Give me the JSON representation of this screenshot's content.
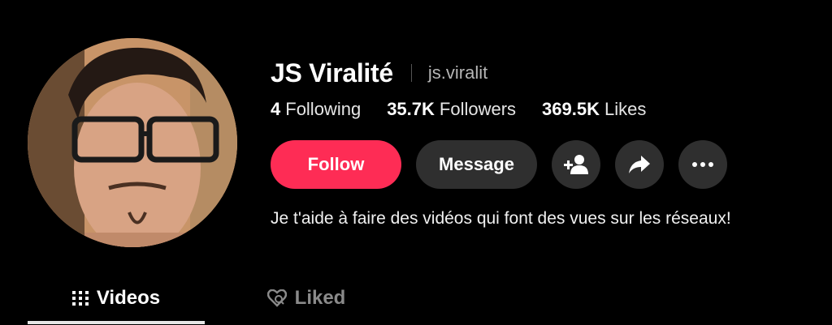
{
  "profile": {
    "display_name": "JS Viralité",
    "handle": "js.viralit",
    "bio": "Je t'aide à faire des vidéos qui font des vues sur les réseaux!"
  },
  "stats": [
    {
      "value": "4",
      "label": "Following"
    },
    {
      "value": "35.7K",
      "label": "Followers"
    },
    {
      "value": "369.5K",
      "label": "Likes"
    }
  ],
  "actions": {
    "follow_label": "Follow",
    "message_label": "Message",
    "icons": [
      "add-friend-icon",
      "share-icon",
      "more-icon"
    ]
  },
  "tabs": [
    {
      "label": "Videos",
      "icon": "grid-icon",
      "active": true
    },
    {
      "label": "Liked",
      "icon": "liked-icon",
      "active": false
    }
  ],
  "colors": {
    "background": "#000000",
    "follow_button": "#fe2c55",
    "secondary_button": "#2f2f2f",
    "handle_text": "#b5b5b5",
    "inactive_tab": "#8a8a8a"
  }
}
